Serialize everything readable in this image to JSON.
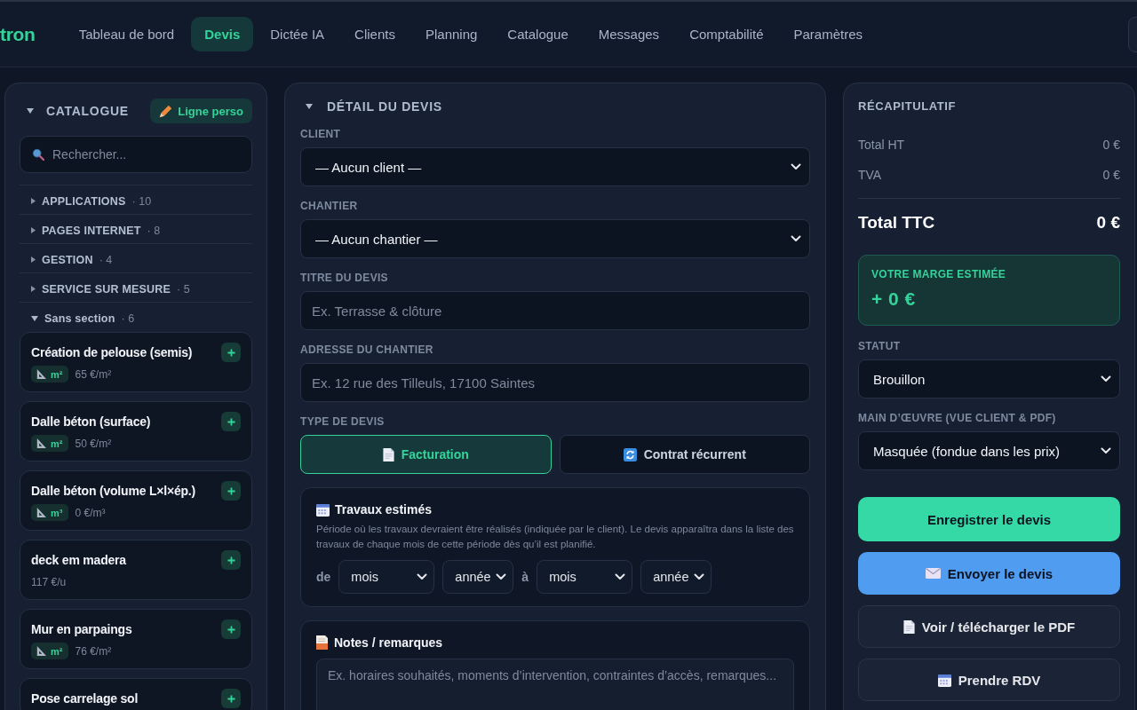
{
  "header": {
    "logo": "tron",
    "nav": [
      {
        "label": "Tableau de bord",
        "selected": false
      },
      {
        "label": "Devis",
        "selected": true
      },
      {
        "label": "Dictée IA",
        "selected": false
      },
      {
        "label": "Clients",
        "selected": false
      },
      {
        "label": "Planning",
        "selected": false
      },
      {
        "label": "Catalogue",
        "selected": false
      },
      {
        "label": "Messages",
        "selected": false
      },
      {
        "label": "Comptabilité",
        "selected": false
      },
      {
        "label": "Paramètres",
        "selected": false
      }
    ]
  },
  "catalogue": {
    "title": "CATALOGUE",
    "expanded": true,
    "custom_line_button": "Ligne perso",
    "search": {
      "placeholder": "Rechercher..."
    },
    "sections": [
      {
        "name": "APPLICATIONS",
        "count": "· 10",
        "expanded": false
      },
      {
        "name": "PAGES INTERNET",
        "count": "· 8",
        "expanded": false
      },
      {
        "name": "GESTION",
        "count": "· 4",
        "expanded": false
      },
      {
        "name": "SERVICE SUR MESURE",
        "count": "· 5",
        "expanded": false
      },
      {
        "name": "Sans section",
        "count": "· 6",
        "expanded": true,
        "items": [
          {
            "name": "Création de pelouse (semis)",
            "unit": "m²",
            "price": "65 €/m²"
          },
          {
            "name": "Dalle béton (surface)",
            "unit": "m²",
            "price": "50 €/m²"
          },
          {
            "name": "Dalle béton (volume L×l×ép.)",
            "unit": "m³",
            "price": "0 €/m³"
          },
          {
            "name": "deck em madera",
            "price": "117 €/u"
          },
          {
            "name": "Mur en parpaings",
            "unit": "m²",
            "price": "76 €/m²"
          },
          {
            "name": "Pose carrelage sol"
          }
        ]
      }
    ]
  },
  "quote_detail": {
    "title": "DÉTAIL DU DEVIS",
    "expanded": true,
    "fields": [
      {
        "kind": "select",
        "label": "CLIENT",
        "value": "— Aucun client —"
      },
      {
        "kind": "select",
        "label": "CHANTIER",
        "value": "— Aucun chantier —"
      },
      {
        "kind": "input",
        "label": "TITRE DU DEVIS",
        "placeholder": "Ex. Terrasse & clôture"
      },
      {
        "kind": "input",
        "label": "ADRESSE DU CHANTIER",
        "placeholder": "Ex. 12 rue des Tilleuls, 17100 Saintes"
      }
    ],
    "quote_type": {
      "label": "TYPE DE DEVIS",
      "options": [
        {
          "label": "Facturation",
          "selected": true
        },
        {
          "label": "Contrat récurrent",
          "selected": false
        }
      ]
    },
    "estimated_work": {
      "title": "Travaux estimés",
      "description": "Période où les travaux devraient être réalisés (indiquée par le client). Le devis apparaîtra dans la liste des travaux de chaque mois de cette période dès qu’il est planifié.",
      "from_label": "de",
      "from_month": "mois",
      "from_year": "année",
      "to_label": "à",
      "to_month": "mois",
      "to_year": "année"
    },
    "notes": {
      "title": "Notes / remarques",
      "placeholder": "Ex. horaires souhaités, moments d’intervention, contraintes d’accès, remarques..."
    }
  },
  "summary": {
    "title": "RÉCAPITULATIF",
    "rows": [
      {
        "label": "Total HT",
        "value": "0 €"
      },
      {
        "label": "TVA",
        "value": "0 €"
      }
    ],
    "total": {
      "label": "Total TTC",
      "value": "0 €"
    },
    "margin": {
      "label": "VOTRE MARGE ESTIMÉE",
      "value": "+ 0 €"
    },
    "status": {
      "label": "STATUT",
      "value": "Brouillon"
    },
    "labour": {
      "label": "MAIN D’ŒUVRE (VUE CLIENT & PDF)",
      "value": "Masquée (fondue dans les prix)"
    },
    "actions": [
      {
        "kind": "primary",
        "label": "Enregistrer le devis"
      },
      {
        "kind": "info",
        "label": "Envoyer le devis"
      },
      {
        "kind": "secondary",
        "label": "Voir / télécharger le PDF"
      },
      {
        "kind": "secondary",
        "label": "Prendre RDV"
      }
    ]
  }
}
